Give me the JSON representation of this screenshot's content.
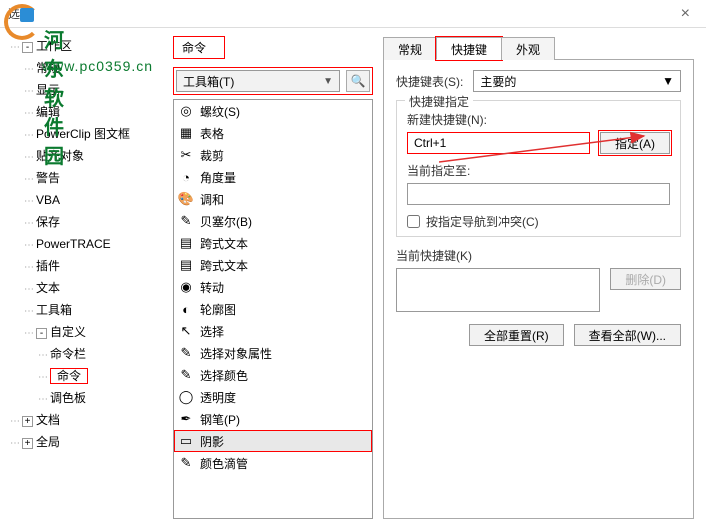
{
  "window": {
    "title": "选项"
  },
  "watermark": {
    "text": "河东软件园",
    "url": "www.pc0359.cn"
  },
  "tree": {
    "root": "工作区",
    "items": [
      "常规",
      "显示",
      "编辑",
      "PowerClip 图文框",
      "贴齐对象",
      "警告",
      "VBA",
      "保存",
      "PowerTRACE",
      "插件",
      "文本",
      "工具箱"
    ],
    "custom": "自定义",
    "custom_items": [
      "命令栏",
      "命令",
      "调色板"
    ],
    "bottom": [
      "文档",
      "全局"
    ]
  },
  "cmd": {
    "heading": "命令",
    "combo": "工具箱(T)",
    "list": [
      {
        "icon": "◎",
        "label": "螺纹(S)"
      },
      {
        "icon": "▦",
        "label": "表格"
      },
      {
        "icon": "✂",
        "label": "裁剪"
      },
      {
        "icon": "◔",
        "label": "角度量"
      },
      {
        "icon": "🎨",
        "label": "调和"
      },
      {
        "icon": "✎",
        "label": "贝塞尔(B)"
      },
      {
        "icon": "▤",
        "label": "跨式文本"
      },
      {
        "icon": "▤",
        "label": "跨式文本"
      },
      {
        "icon": "◉",
        "label": "转动"
      },
      {
        "icon": "◐",
        "label": "轮廓图"
      },
      {
        "icon": "↖",
        "label": "选择"
      },
      {
        "icon": "✎",
        "label": "选择对象属性"
      },
      {
        "icon": "✎",
        "label": "选择颜色"
      },
      {
        "icon": "◯",
        "label": "透明度"
      },
      {
        "icon": "✒",
        "label": "钢笔(P)"
      },
      {
        "icon": "▭",
        "label": "阴影"
      },
      {
        "icon": "✎",
        "label": "颜色滴管"
      }
    ],
    "selected_index": 15
  },
  "tabs": {
    "items": [
      "常规",
      "快捷键",
      "外观"
    ],
    "active": 1
  },
  "shortcut": {
    "table_label": "快捷键表(S):",
    "table_value": "主要的",
    "group_label": "快捷键指定",
    "new_label": "新建快捷键(N):",
    "new_value": "Ctrl+1",
    "assign_btn": "指定(A)",
    "current_to_label": "当前指定至:",
    "conflict_cb": "按指定导航到冲突(C)",
    "current_label": "当前快捷键(K)",
    "delete_btn": "删除(D)",
    "reset_btn": "全部重置(R)",
    "viewall_btn": "查看全部(W)..."
  }
}
